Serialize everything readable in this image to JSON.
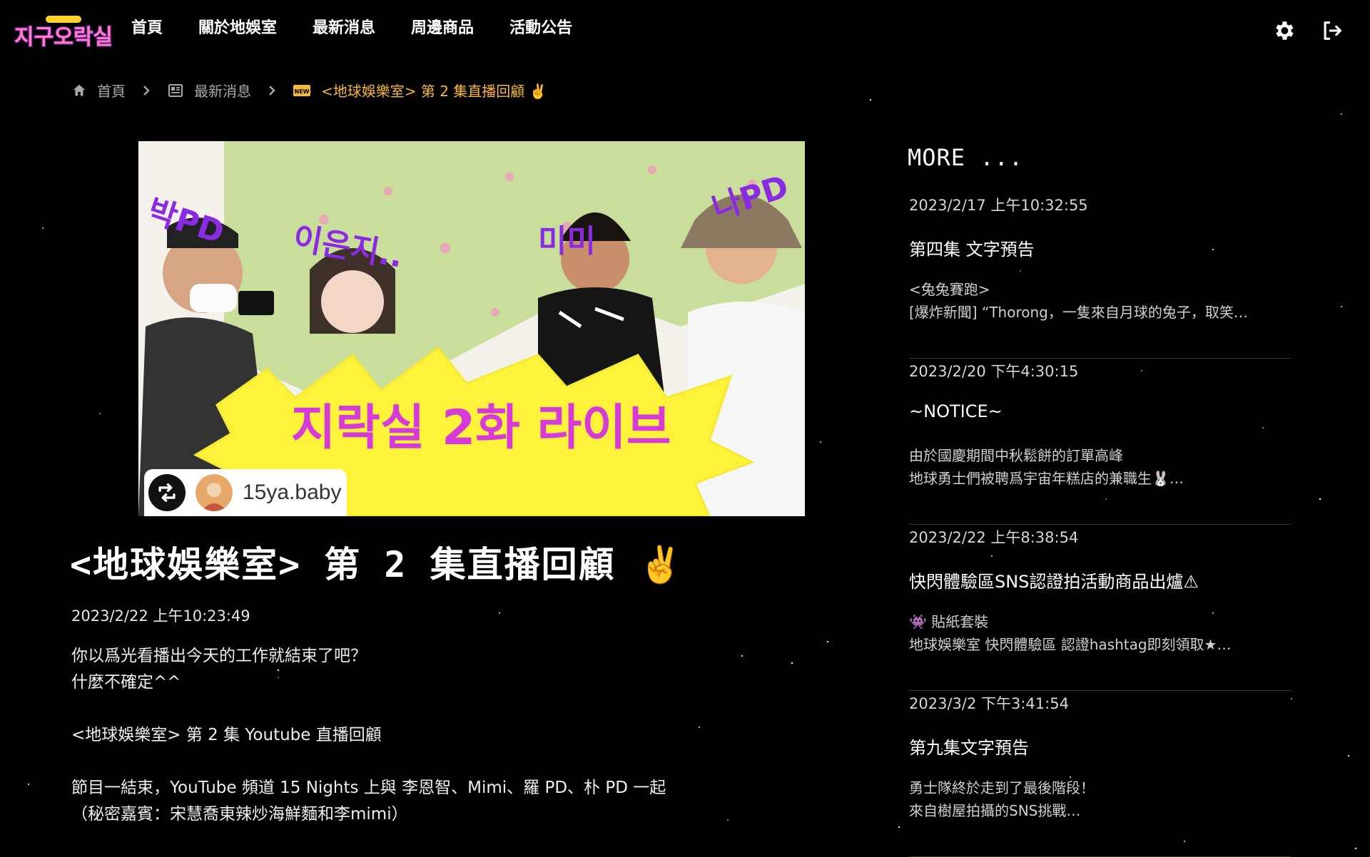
{
  "nav": {
    "logo_alt": "지구오락실",
    "links": [
      "首頁",
      "關於地娛室",
      "最新消息",
      "周邊商品",
      "活動公告"
    ],
    "settings_icon": "gear-icon",
    "logout_icon": "logout-icon"
  },
  "breadcrumb": {
    "home": "首頁",
    "news": "最新消息",
    "current": "<地球娛樂室> 第 2 集直播回顧 ✌️"
  },
  "hero": {
    "overlay_text": "지락실 2화 라이브",
    "labels": [
      "박PD",
      "이은지..",
      "미미",
      "나PD"
    ],
    "badge_name": "15ya.baby"
  },
  "article": {
    "title": "<地球娛樂室> 第 2 集直播回顧 ✌️",
    "date": "2023/2/22 上午10:23:49",
    "paragraphs": [
      "你以爲光看播出今天的工作就結束了吧？",
      "什麼不確定^^",
      "",
      "<地球娛樂室> 第 2 集 Youtube 直播回顧",
      "",
      "節目一結束，YouTube 頻道 15 Nights 上與 李恩智、Mimi、羅 PD、朴 PD 一起",
      "（秘密嘉賓：宋慧喬東辣炒海鮮麵和李mimi）"
    ]
  },
  "sidebar": {
    "heading": "MORE ...",
    "items": [
      {
        "date": "2023/2/17 上午10:32:55",
        "title": "第四集 文字預告",
        "line1": "<兔兔賽跑>",
        "line2": "[爆炸新聞] “Thorong，一隻來自月球的兔子，取笑…"
      },
      {
        "date": "2023/2/20 下午4:30:15",
        "title": "~NOTICE~",
        "line1": "由於國慶期間中秋鬆餅的訂單高峰",
        "line2": "地球勇士們被聘爲宇宙年糕店的兼職生🐰…"
      },
      {
        "date": "2023/2/22 上午8:38:54",
        "title": "快閃體驗區SNS認證拍活動商品出爐⚠",
        "line1": "👾 貼紙套裝",
        "line2": "地球娛樂室 快閃體驗區 認證hashtag即刻領取★…"
      },
      {
        "date": "2023/3/2 下午3:41:54",
        "title": "第九集文字預告",
        "line1": "勇士隊終於走到了最後階段！",
        "line2": "來自樹屋拍攝的SNS挑戰…"
      }
    ]
  }
}
